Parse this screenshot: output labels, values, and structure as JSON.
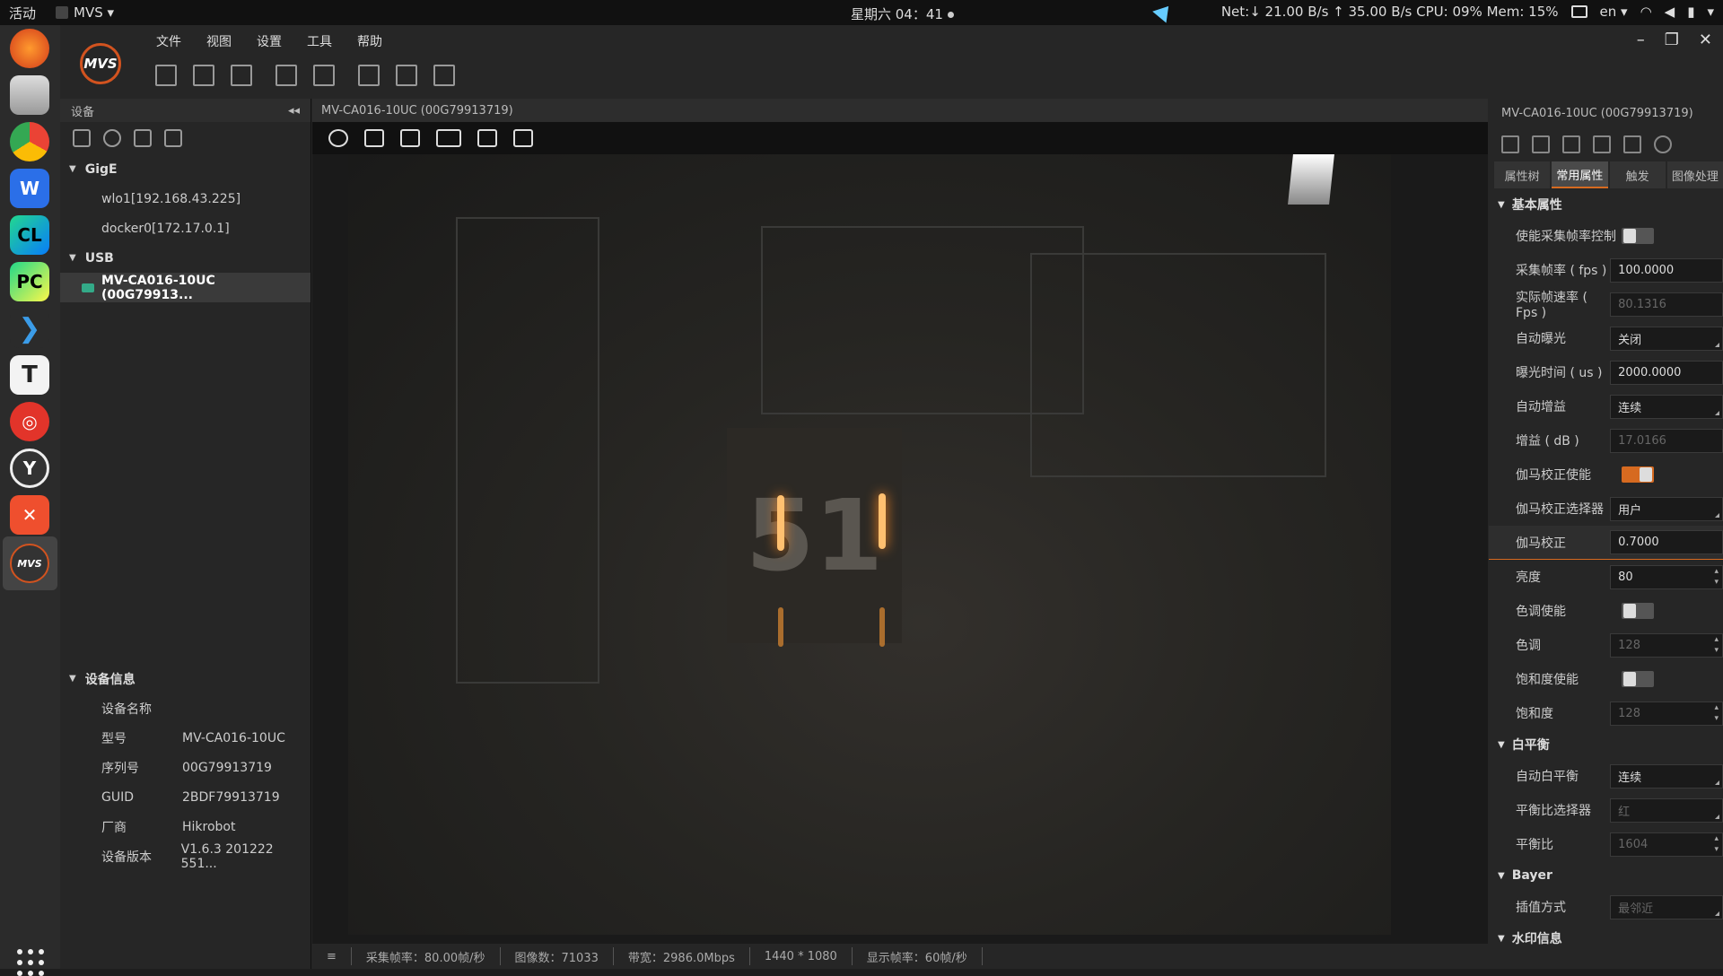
{
  "topbar": {
    "activities": "活动",
    "app_name": "MVS ▾",
    "clock": "星期六 04：41",
    "net_stats": "Net:↓  21.00 B/s ↑  35.00 B/s CPU: 09% Mem: 15%",
    "lang": "en ▾"
  },
  "dock": {
    "apps": [
      "firefox-icon",
      "files-icon",
      "chrome-icon",
      "wps-icon",
      "clion-icon",
      "pycharm-icon",
      "vscode-icon",
      "typora-icon",
      "netease-music-icon",
      "tool-icon",
      "xmind-icon",
      "mvs-icon"
    ],
    "mvs_label": "MVS"
  },
  "menu": {
    "file": "文件",
    "view": "视图",
    "settings": "设置",
    "tools": "工具",
    "help": "帮助"
  },
  "window_controls": {
    "minimize": "–",
    "maximize": "❐",
    "close": "✕"
  },
  "logo_text": "MVS",
  "left_panel": {
    "title": "设备",
    "collapse": "◂◂",
    "gige_label": "GigE",
    "gige_items": [
      "wlo1[192.168.43.225]",
      "docker0[172.17.0.1]"
    ],
    "usb_label": "USB",
    "usb_item": "MV-CA016-10UC (00G79913...",
    "device_info_label": "设备信息",
    "device_info": [
      {
        "key": "设备名称",
        "value": ""
      },
      {
        "key": "型号",
        "value": "MV-CA016-10UC"
      },
      {
        "key": "序列号",
        "value": "00G79913719"
      },
      {
        "key": "GUID",
        "value": "2BDF79913719"
      },
      {
        "key": "厂商",
        "value": "Hikrobot"
      },
      {
        "key": "设备版本",
        "value": "V1.6.3 201222 551..."
      }
    ]
  },
  "center": {
    "title": "MV-CA016-10UC (00G79913719)",
    "scene_digits": "51",
    "status": {
      "acq_rate": "采集帧率：80.00帧/秒",
      "image_count": "图像数：71033",
      "bandwidth": "带宽：2986.0Mbps",
      "resolution": "1440 * 1080",
      "display_rate": "显示帧率：60帧/秒"
    }
  },
  "right_panel": {
    "title": "MV-CA016-10UC (00G79913719)",
    "tabs": [
      "属性树",
      "常用属性",
      "触发",
      "图像处理"
    ],
    "active_tab": "常用属性",
    "sections": {
      "basic": "基本属性",
      "wb": "白平衡",
      "bayer": "Bayer",
      "watermark": "水印信息"
    },
    "props": {
      "enable_fps_ctrl": "使能采集帧率控制",
      "fps": "采集帧率 ( fps )",
      "fps_val": "100.0000",
      "real_fps": "实际帧速率 ( Fps )",
      "real_fps_val": "80.1316",
      "auto_exposure": "自动曝光",
      "auto_exposure_val": "关闭",
      "exposure_time": "曝光时间 ( us )",
      "exposure_time_val": "2000.0000",
      "auto_gain": "自动增益",
      "auto_gain_val": "连续",
      "gain": "增益 ( dB )",
      "gain_val": "17.0166",
      "gamma_enable": "伽马校正使能",
      "gamma_selector": "伽马校正选择器",
      "gamma_selector_val": "用户",
      "gamma": "伽马校正",
      "gamma_val": "0.7000",
      "brightness": "亮度",
      "brightness_val": "80",
      "hue_enable": "色调使能",
      "hue": "色调",
      "hue_val": "128",
      "sat_enable": "饱和度使能",
      "saturation": "饱和度",
      "saturation_val": "128",
      "auto_wb": "自动白平衡",
      "auto_wb_val": "连续",
      "balance_selector": "平衡比选择器",
      "balance_selector_val": "红",
      "balance_ratio": "平衡比",
      "balance_ratio_val": "1604",
      "interp": "插值方式",
      "interp_val": "最邻近"
    }
  }
}
